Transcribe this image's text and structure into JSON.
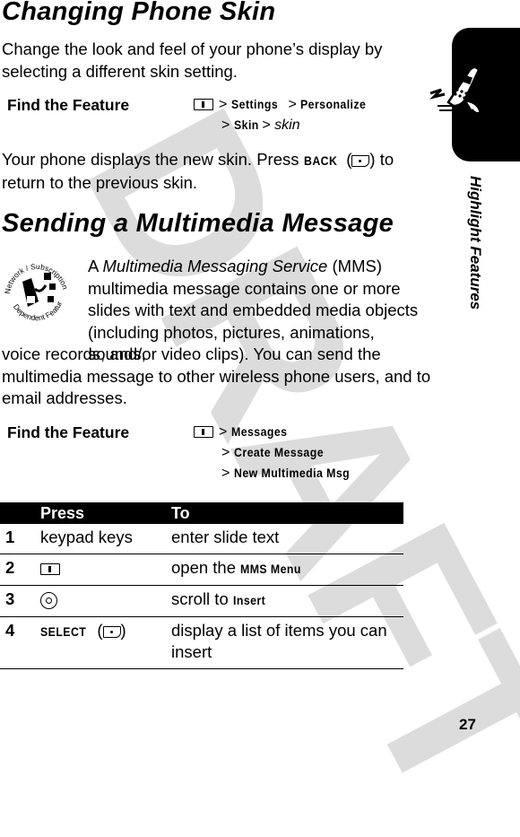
{
  "watermark": "DRAFT",
  "section1": {
    "title": "Changing Phone Skin",
    "intro": "Change the look and feel of your phone’s display by selecting a different skin setting.",
    "find_feature": {
      "label": "Find the Feature",
      "key_icon": "menu-key-icon",
      "path_line1": [
        "Settings",
        "Personalize"
      ],
      "path_line2_cmd": "Skin",
      "path_line2_var": "skin"
    },
    "after_pre": "Your phone displays the new skin. Press ",
    "after_cmd": "BACK",
    "after_post1": ") to",
    "after_post2": "return to the previous skin."
  },
  "section2": {
    "title": "Sending a Multimedia Message",
    "badge": {
      "top": "Network / Subscription",
      "bottom": "Dependent Feature"
    },
    "intro_lines": [
      "A ",
      "Multimedia Messaging Service",
      " (MMS)",
      "multimedia message contains one or more",
      "slides with text and embedded media objects",
      "(including photos, pictures, animations, sounds,",
      "voice records, and/or video clips). You can send the",
      "multimedia message to other wireless phone users, and to",
      "email addresses."
    ],
    "find_feature": {
      "label": "Find the Feature",
      "path": [
        "Messages",
        "Create Message",
        "New Multimedia Msg"
      ]
    },
    "table": {
      "headers": [
        "",
        "Press",
        "To"
      ],
      "rows": [
        {
          "num": "1",
          "press": "keypad keys",
          "to_pre": "enter slide text",
          "to_cmd": ""
        },
        {
          "num": "2",
          "press_icon": "menu-key-icon",
          "to_pre": "open the ",
          "to_cmd": "MMS Menu"
        },
        {
          "num": "3",
          "press_icon": "nav-key-icon",
          "to_pre": "scroll to ",
          "to_cmd": "Insert"
        },
        {
          "num": "4",
          "press_cmd": "SELECT",
          "press_icon": "soft-key-icon",
          "to_pre": "display a list of items you can insert",
          "to_cmd": ""
        }
      ]
    }
  },
  "side_tab": {
    "label": "Highlight Features"
  },
  "page_number": "27"
}
